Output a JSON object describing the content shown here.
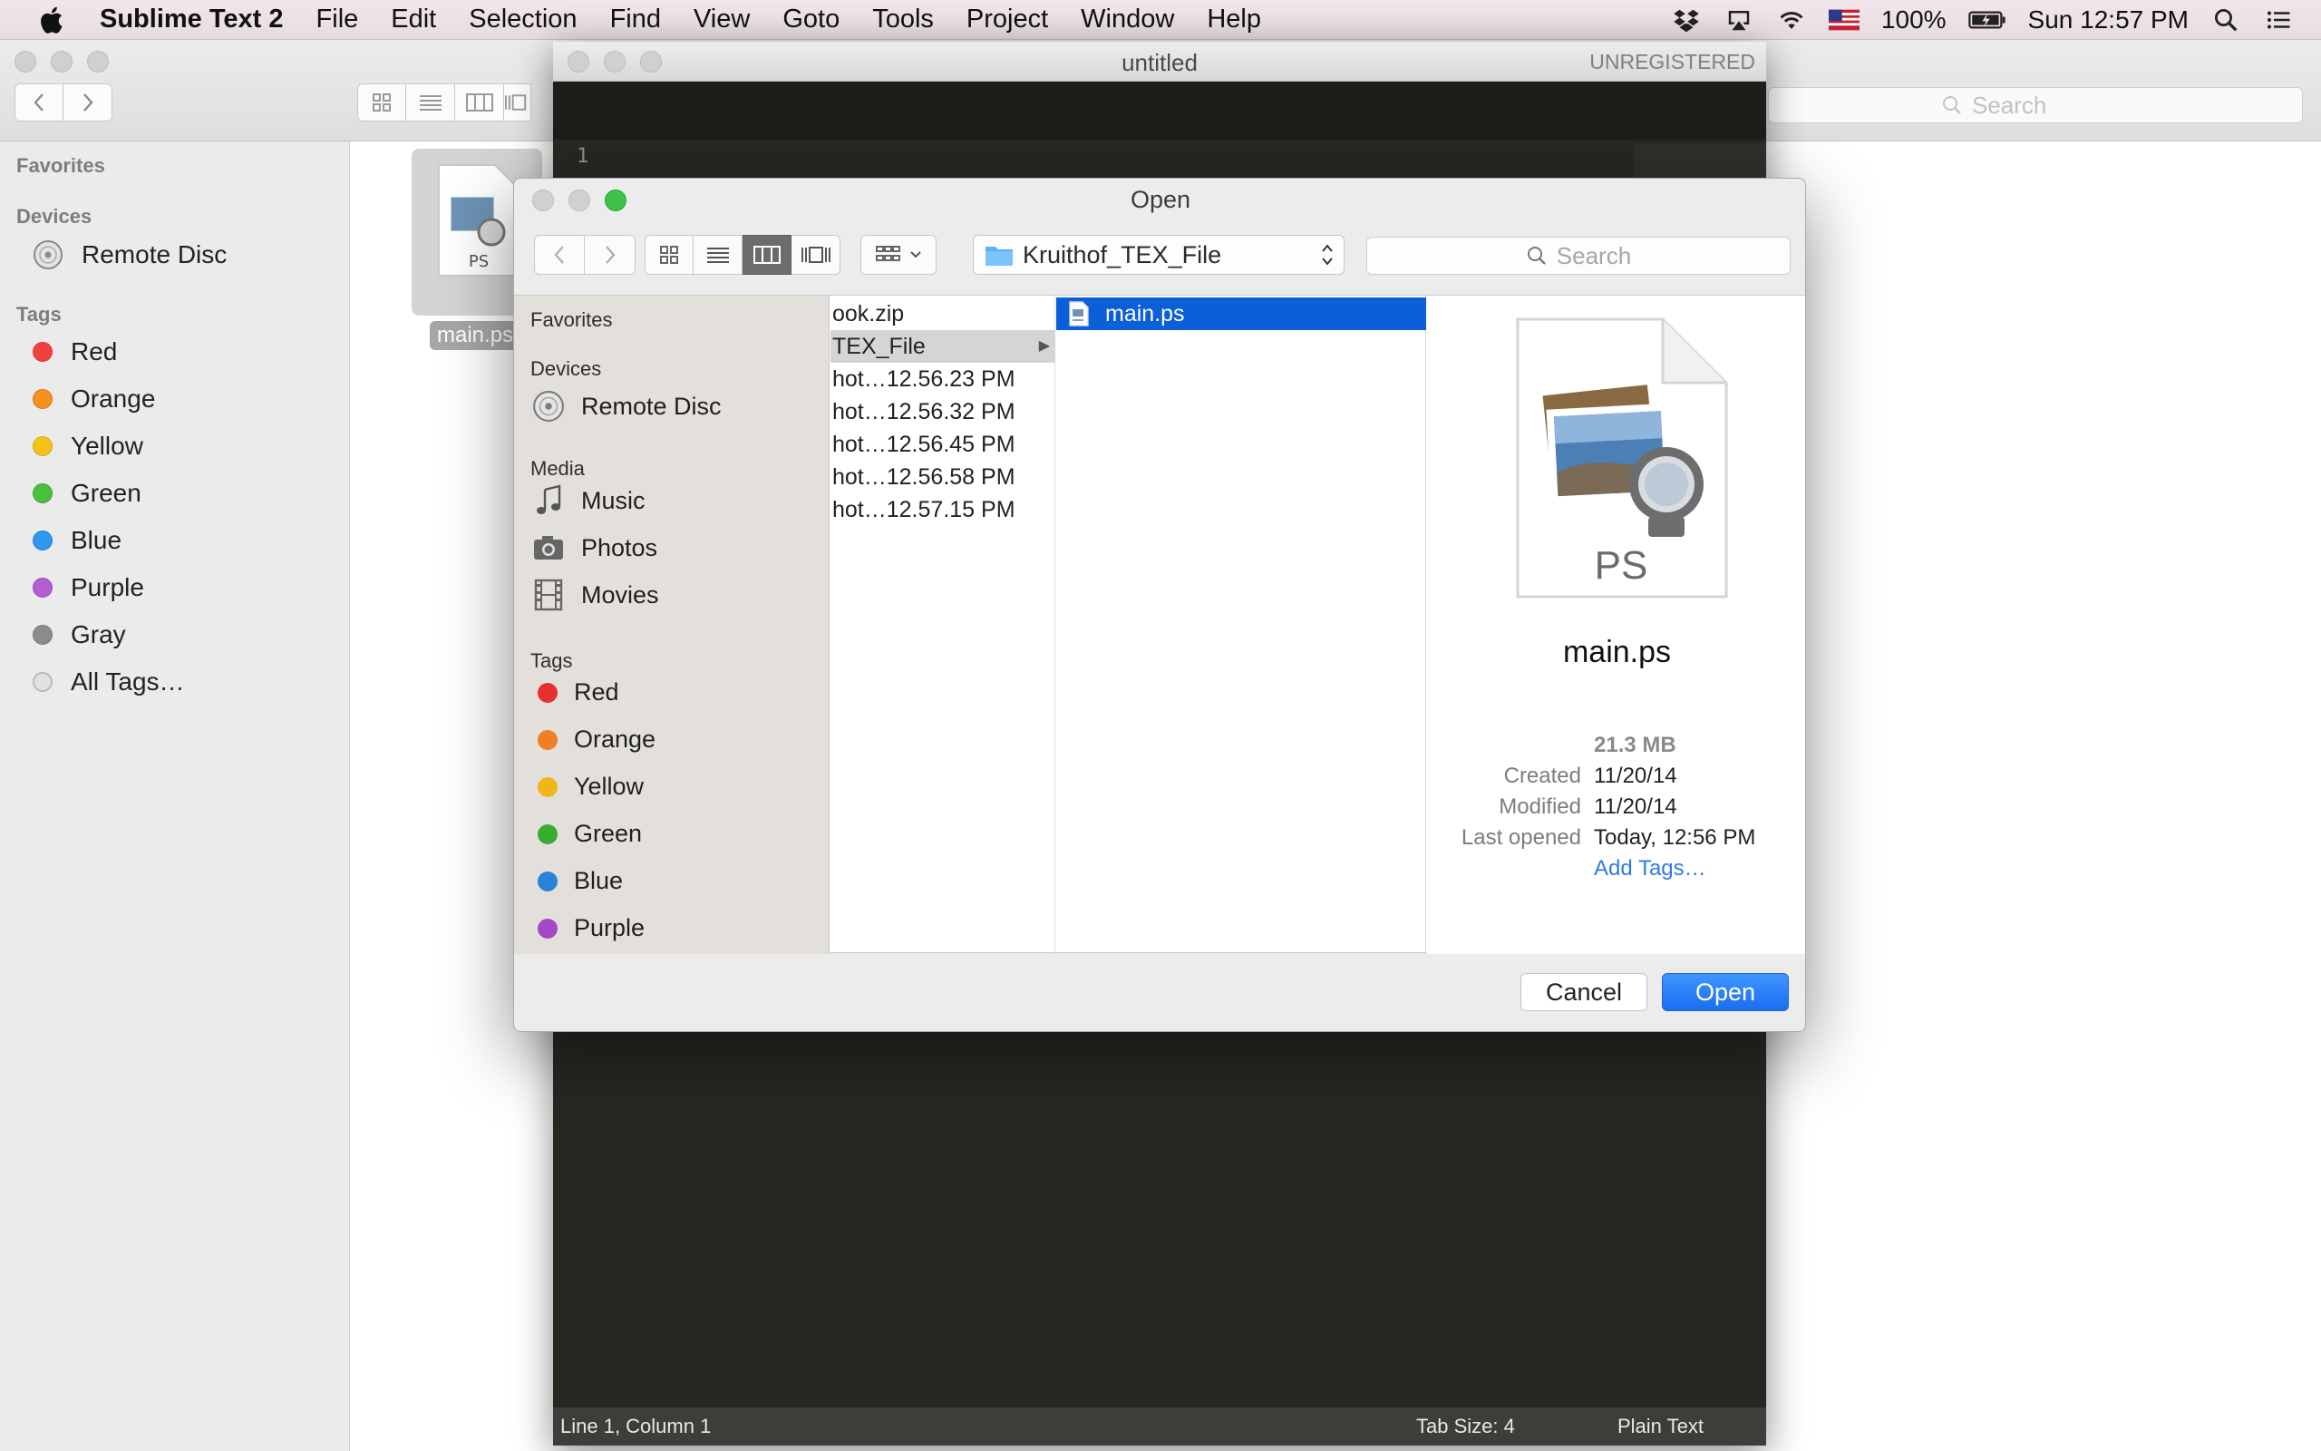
{
  "menubar": {
    "app_name": "Sublime Text 2",
    "items": [
      "File",
      "Edit",
      "Selection",
      "Find",
      "View",
      "Goto",
      "Tools",
      "Project",
      "Window",
      "Help"
    ],
    "battery": "100%",
    "clock": "Sun 12:57 PM"
  },
  "finder": {
    "search_placeholder": "Search",
    "sidebar": {
      "favorites_heading": "Favorites",
      "devices_heading": "Devices",
      "remote_disc": "Remote Disc",
      "tags_heading": "Tags",
      "tags": [
        {
          "label": "Red",
          "color": "#f2403c"
        },
        {
          "label": "Orange",
          "color": "#f6901e"
        },
        {
          "label": "Yellow",
          "color": "#f5c219"
        },
        {
          "label": "Green",
          "color": "#4bc03a"
        },
        {
          "label": "Blue",
          "color": "#2e97ee"
        },
        {
          "label": "Purple",
          "color": "#b45dd3"
        },
        {
          "label": "Gray",
          "color": "#8c8c8c"
        }
      ],
      "all_tags": "All Tags…"
    },
    "file_label": "main.ps",
    "file_badge": "PS"
  },
  "sublime": {
    "window_title": "untitled",
    "unregistered": "UNREGISTERED",
    "line_number": "1",
    "status_left": "Line 1, Column 1",
    "status_tab": "Tab Size: 4",
    "status_syntax": "Plain Text"
  },
  "dialog": {
    "title": "Open",
    "path": "Kruithof_TEX_File",
    "search_placeholder": "Search",
    "sidebar": {
      "favorites_heading": "Favorites",
      "devices_heading": "Devices",
      "remote_disc": "Remote Disc",
      "media_heading": "Media",
      "media": [
        {
          "label": "Music",
          "icon": "music-note-icon"
        },
        {
          "label": "Photos",
          "icon": "camera-icon"
        },
        {
          "label": "Movies",
          "icon": "film-icon"
        }
      ],
      "tags_heading": "Tags",
      "tags": [
        {
          "label": "Red",
          "color": "#e5312e"
        },
        {
          "label": "Orange",
          "color": "#ee7f22"
        },
        {
          "label": "Yellow",
          "color": "#efb51b"
        },
        {
          "label": "Green",
          "color": "#38ac2e"
        },
        {
          "label": "Blue",
          "color": "#2a82d8"
        },
        {
          "label": "Purple",
          "color": "#a548c5"
        }
      ]
    },
    "column1": [
      "ook.zip",
      "TEX_File",
      "hot…12.56.23 PM",
      "hot…12.56.32 PM",
      "hot…12.56.45 PM",
      "hot…12.56.58 PM",
      "hot…12.57.15 PM"
    ],
    "column2": [
      "main.ps"
    ],
    "preview": {
      "badge": "PS",
      "name": "main.ps",
      "size": "21.3 MB",
      "created_label": "Created",
      "created": "11/20/14",
      "modified_label": "Modified",
      "modified": "11/20/14",
      "last_opened_label": "Last opened",
      "last_opened": "Today, 12:56 PM",
      "add_tags": "Add Tags…"
    },
    "cancel": "Cancel",
    "open": "Open",
    "accent_color": "#0b5fd8"
  }
}
